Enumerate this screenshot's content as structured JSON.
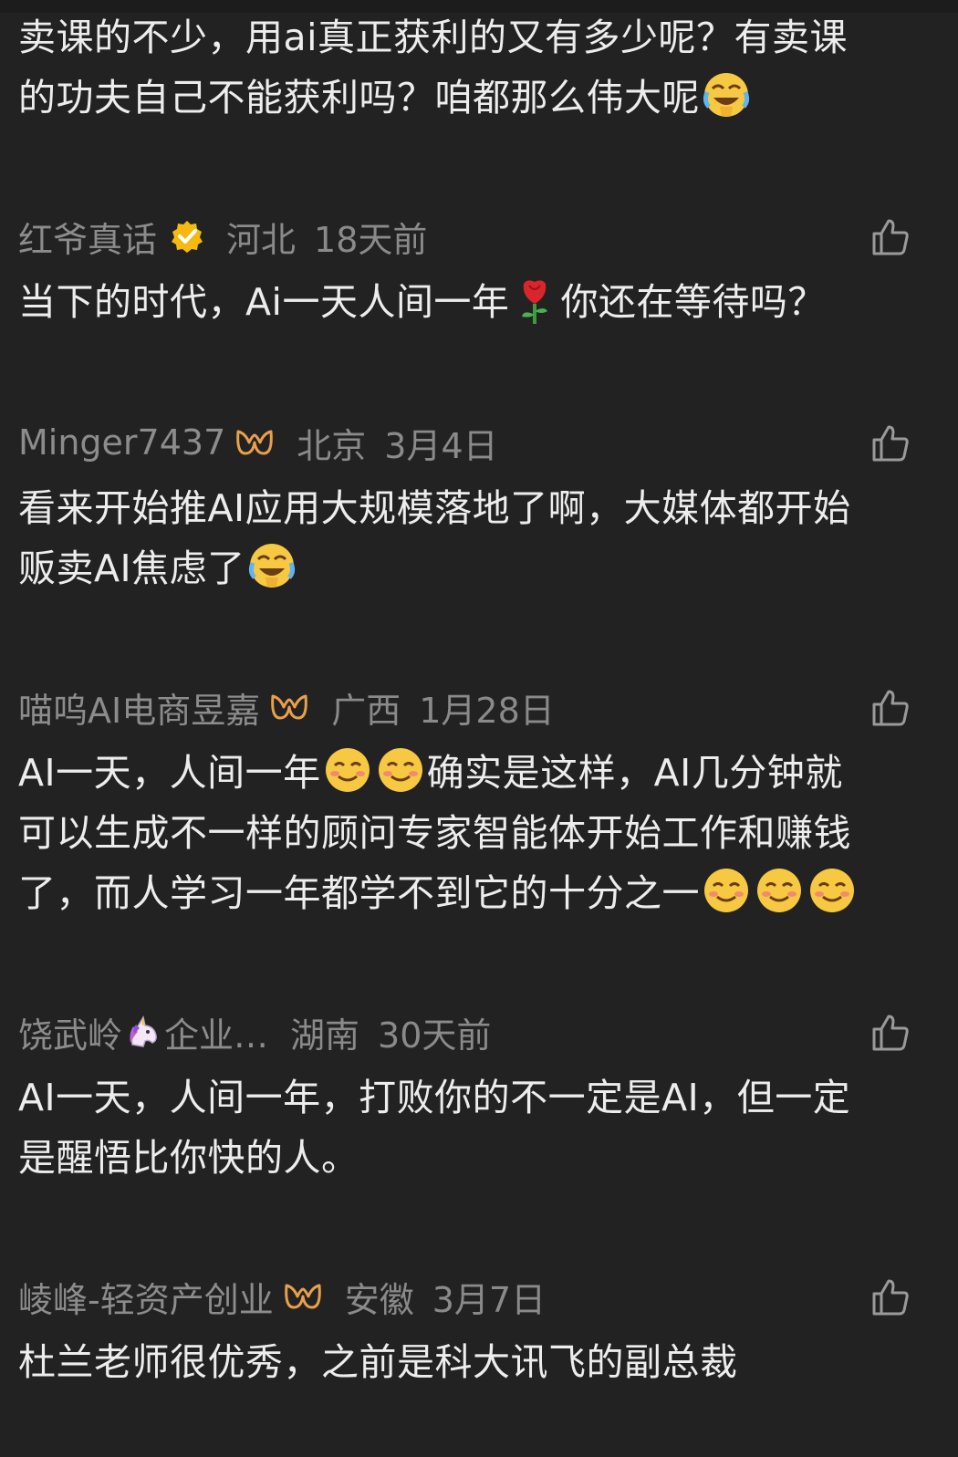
{
  "comments": [
    {
      "text_lines": [
        "卖课的不少，用ai真正获利的又有多少呢？有卖课",
        "的功夫自己不能获利吗？咱都那么伟大呢"
      ],
      "emoji": "rofl-emoji"
    },
    {
      "user": "红爷真话",
      "location": "河北",
      "time": "18天前",
      "text_a": "当下的时代，Ai一天人间一年",
      "text_b": "你还在等待吗？",
      "emoji": "rose-emoji"
    },
    {
      "user": "Minger7437",
      "location": "北京",
      "time": "3月4日",
      "text_lines": [
        "看来开始推AI应用大规模落地了啊，大媒体都开始",
        "贩卖AI焦虑了"
      ],
      "emoji": "rofl-emoji"
    },
    {
      "user": "喵呜AI电商昱嘉",
      "location": "广西",
      "time": "1月28日",
      "line1_a": "AI一天，人间一年",
      "line1_b": "确实是这样，AI几分钟就",
      "line2": "可以生成不一样的顾问专家智能体开始工作和赚钱",
      "line3": "了，而人学习一年都学不到它的十分之一",
      "emoji": "smile-emoji"
    },
    {
      "user_a": "饶武岭",
      "user_b": "企业…",
      "location": "湖南",
      "time": "30天前",
      "text_lines": [
        "AI一天，人间一年，打败你的不一定是AI，但一定",
        "是醒悟比你快的人。"
      ]
    },
    {
      "user": "崚峰-轻资产创业",
      "location": "安徽",
      "time": "3月7日",
      "text_lines": [
        "杜兰老师很优秀，之前是科大讯飞的副总裁"
      ]
    }
  ],
  "icons": {
    "like": "thumbs-up-icon",
    "verified": "verified-badge-icon",
    "member": "w-member-badge-icon"
  },
  "colors": {
    "background": "#222222",
    "text": "#ededed",
    "meta": "#8a8a8a",
    "verified_gold": "#f5b90f",
    "badge_orange": "#e8a04a"
  }
}
